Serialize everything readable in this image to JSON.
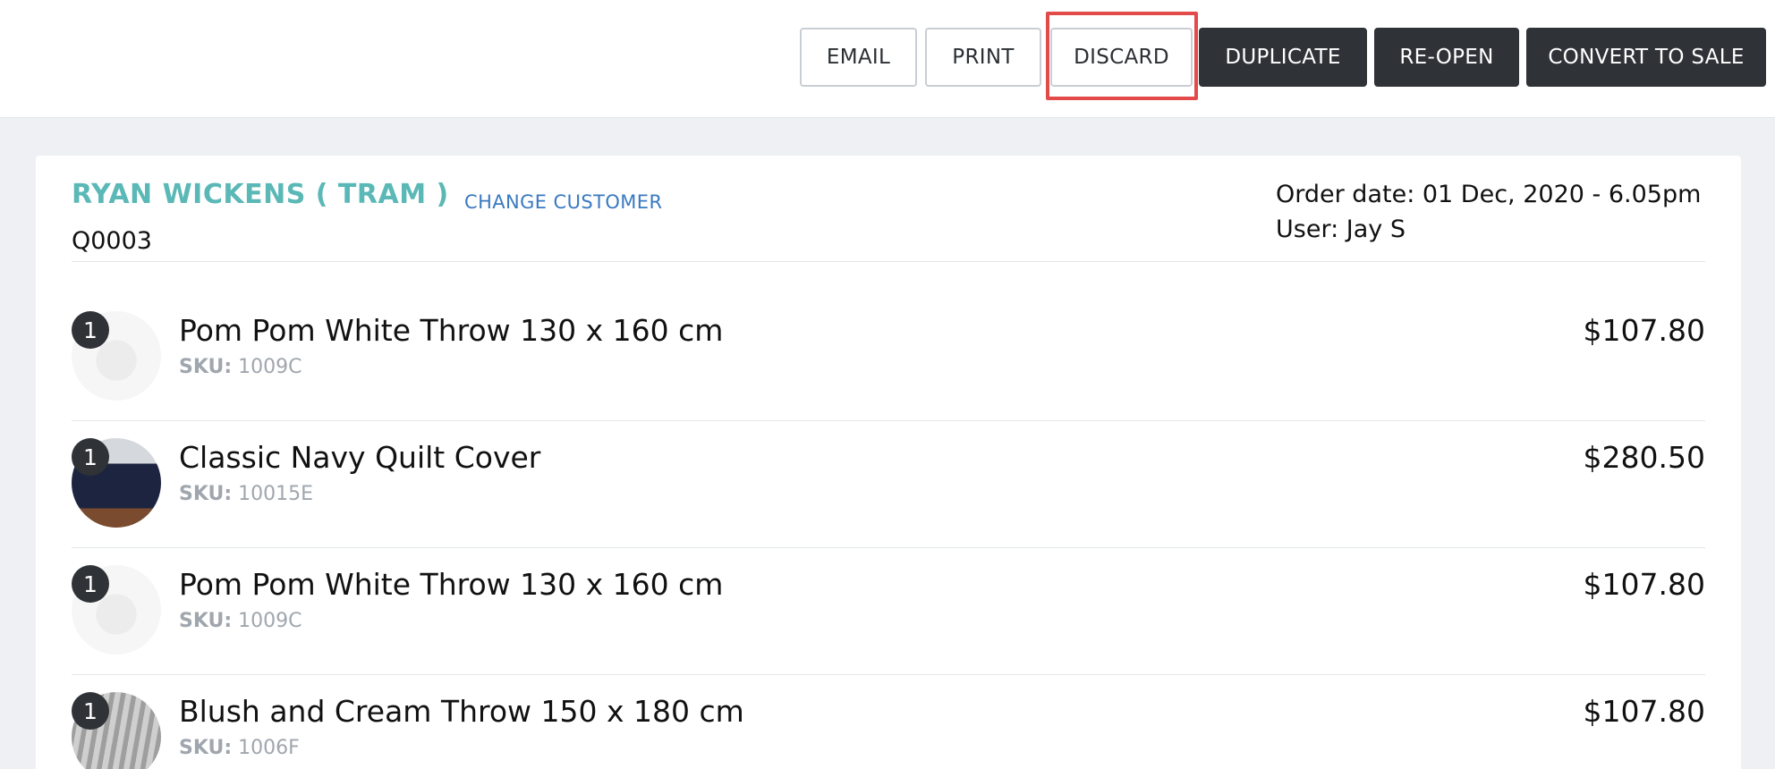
{
  "toolbar": {
    "email_label": "EMAIL",
    "print_label": "PRINT",
    "discard_label": "DISCARD",
    "duplicate_label": "DUPLICATE",
    "reopen_label": "RE-OPEN",
    "convert_label": "CONVERT TO SALE"
  },
  "customer": {
    "name": "RYAN WICKENS ( TRAM )",
    "change_label": "CHANGE CUSTOMER",
    "quote_number": "Q0003"
  },
  "order": {
    "date_text": "Order date: 01 Dec, 2020 - 6.05pm",
    "user_text": "User: Jay S"
  },
  "items": [
    {
      "qty": "1",
      "name": "Pom Pom White Throw 130 x 160 cm",
      "sku_label": "SKU:",
      "sku": "1009C",
      "price": "$107.80",
      "thumb": "white-throw-image"
    },
    {
      "qty": "1",
      "name": "Classic Navy Quilt Cover",
      "sku_label": "SKU:",
      "sku": "10015E",
      "price": "$280.50",
      "thumb": "navy-quilt-image"
    },
    {
      "qty": "1",
      "name": "Pom Pom White Throw 130 x 160 cm",
      "sku_label": "SKU:",
      "sku": "1009C",
      "price": "$107.80",
      "thumb": "white-throw-image"
    },
    {
      "qty": "1",
      "name": "Blush and Cream Throw 150 x 180 cm",
      "sku_label": "SKU:",
      "sku": "1006F",
      "price": "$107.80",
      "thumb": "blush-throw-image"
    }
  ],
  "colors": {
    "customer_name": "#5ab8b6",
    "link": "#3b7ac0",
    "dark_button": "#2f3337",
    "highlight": "#e34b4b"
  }
}
